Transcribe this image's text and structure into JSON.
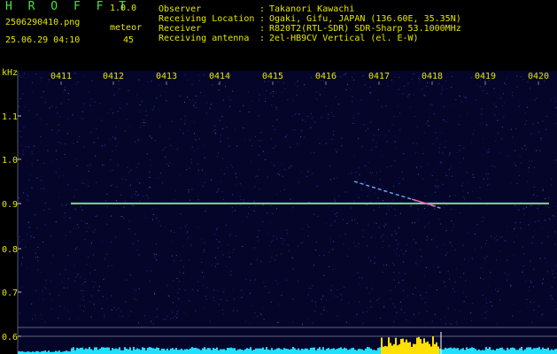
{
  "header": {
    "app_name": "H R O F F T",
    "version": "1.0.0",
    "filename": "2506290410.png",
    "meteor_label": "meteor",
    "datetime": "25.06.29 04:10",
    "meteor_count": "45"
  },
  "info": {
    "rows": [
      {
        "key": "Observer",
        "value": "Takanori Kawachi"
      },
      {
        "key": "Receiving Location",
        "value": "Ogaki, Gifu, JAPAN (136.60E, 35.35N)"
      },
      {
        "key": "Receiver",
        "value": "R820T2(RTL-SDR) SDR-Sharp 53.1000MHz"
      },
      {
        "key": "Receiving antenna",
        "value": "2el-HB9CV Vertical (el. E-W)"
      }
    ]
  },
  "plot": {
    "unit_label": "kHz",
    "time_ticks": [
      "0411",
      "0412",
      "0413",
      "0414",
      "0415",
      "0416",
      "0417",
      "0418",
      "0419",
      "0420"
    ],
    "freq_ticks": [
      "1.1",
      "1.0",
      "0.9",
      "0.8",
      "0.7",
      "0.6"
    ],
    "colors": {
      "background": "#05052a",
      "carrier": "#b0ff80",
      "meteor": "#60b0ff",
      "noise": "#20e0ff",
      "burst": "#ffe000"
    }
  }
}
